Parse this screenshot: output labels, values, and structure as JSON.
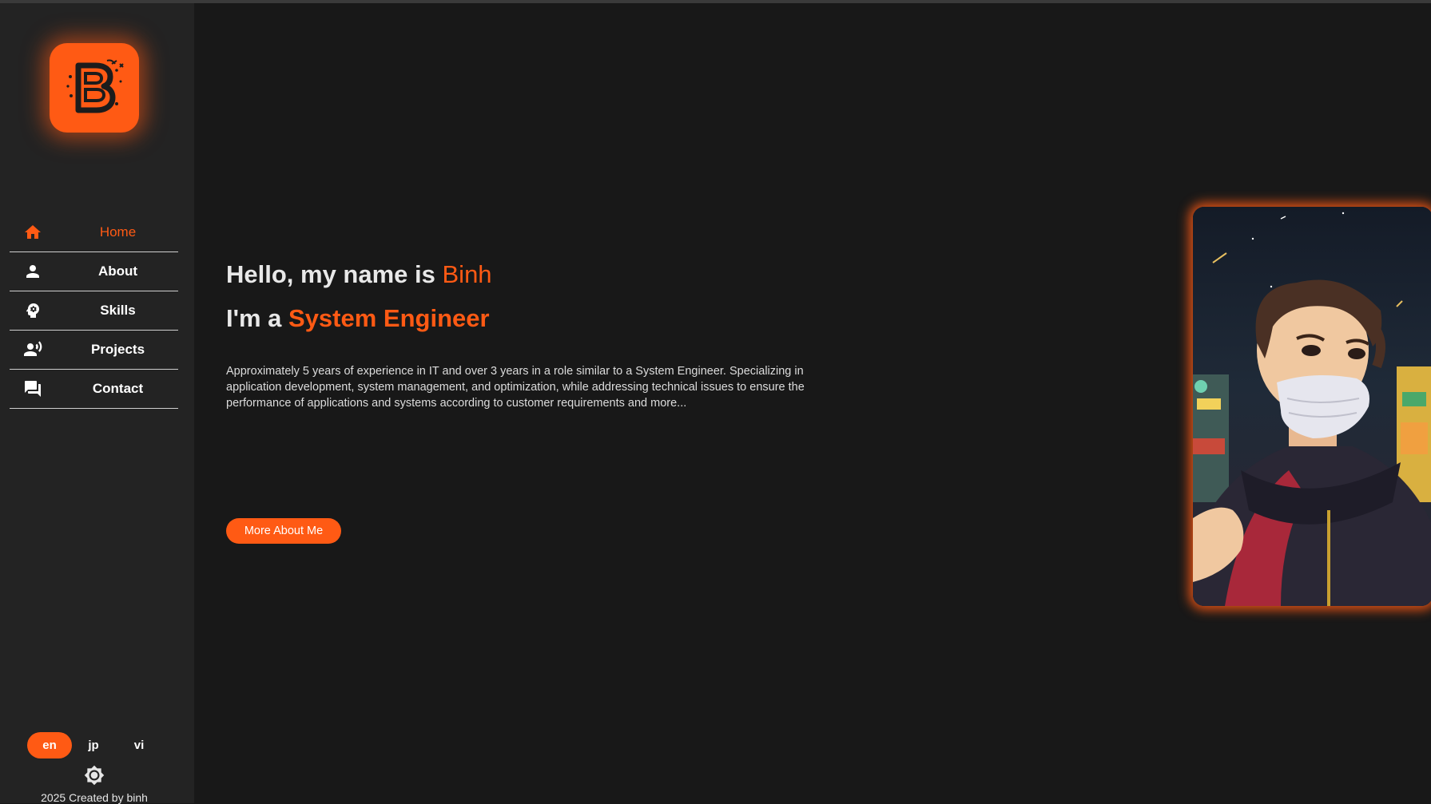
{
  "sidebar": {
    "logo_letter": "B",
    "nav": [
      {
        "label": "Home",
        "icon": "home-icon",
        "active": true
      },
      {
        "label": "About",
        "icon": "person-icon",
        "active": false
      },
      {
        "label": "Skills",
        "icon": "head-gear-icon",
        "active": false
      },
      {
        "label": "Projects",
        "icon": "people-icon",
        "active": false
      },
      {
        "label": "Contact",
        "icon": "chat-icon",
        "active": false
      }
    ],
    "languages": [
      {
        "label": "en",
        "active": true
      },
      {
        "label": "jp",
        "active": false
      },
      {
        "label": "vi",
        "active": false
      }
    ],
    "theme_icon": "brightness-icon",
    "footer": "2025 Created by binh"
  },
  "hero": {
    "greeting_prefix": "Hello, my name is ",
    "name": "Binh",
    "role_prefix": "I'm a ",
    "role": "System Engineer",
    "description": "Approximately 5 years of experience in IT and over 3 years in a role similar to a System Engineer. Specializing in application development, system management, and optimization, while addressing technical issues to ensure the performance of applications and systems according to customer requirements and more...",
    "cta_label": "More About Me"
  },
  "colors": {
    "accent": "#ff5a14",
    "background": "#181818",
    "sidebar": "#232323"
  }
}
